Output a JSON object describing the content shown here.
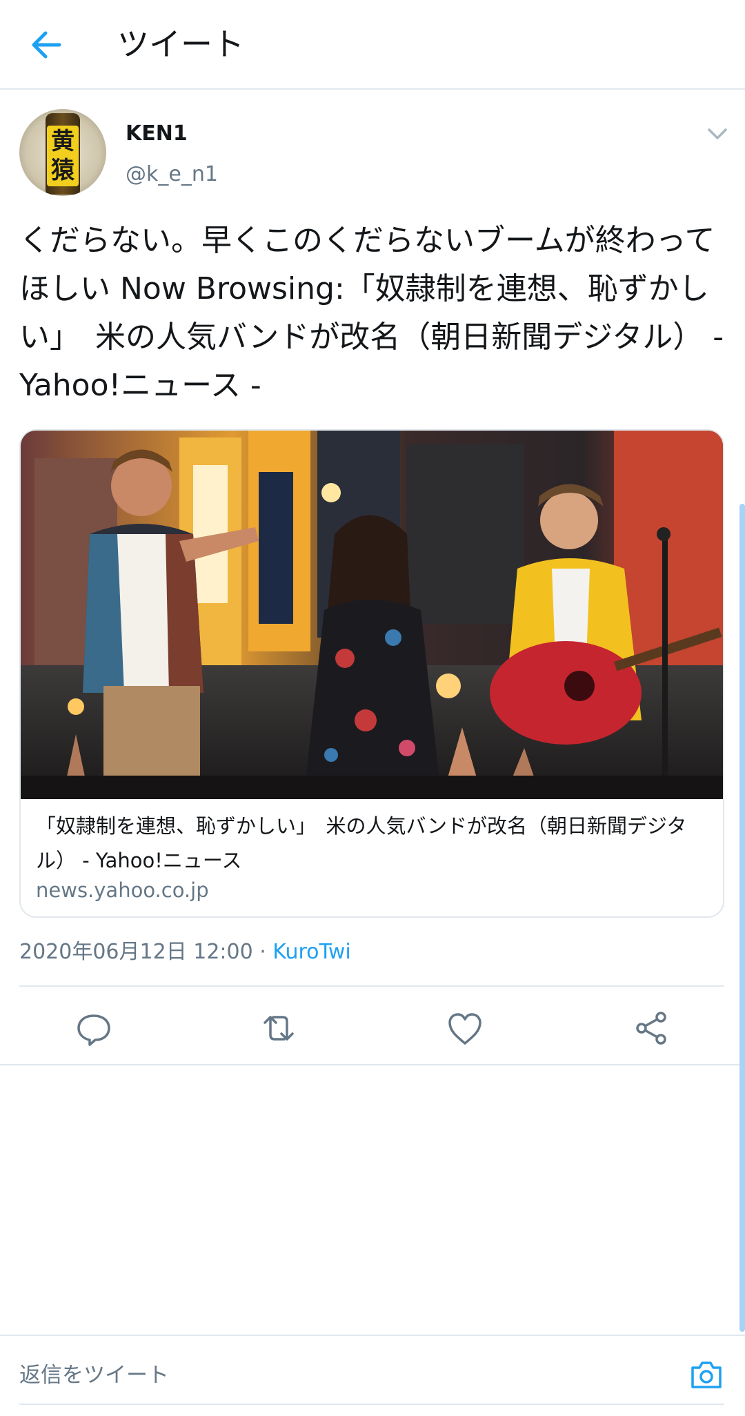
{
  "header": {
    "title": "ツイート"
  },
  "author": {
    "name": "KEN1",
    "handle": "@k_e_n1",
    "avatar_text": "黄猿"
  },
  "tweet": {
    "text": "くだらない。早くこのくだらないブームが終わってほしい Now Browsing:「奴隷制を連想、恥ずかしい」　米の人気バンドが改名（朝日新聞デジタル） - Yahoo!ニュース -"
  },
  "card": {
    "title": "「奴隷制を連想、恥ずかしい」　米の人気バンドが改名（朝日新聞デジタル） - Yahoo!ニュース",
    "domain": "news.yahoo.co.jp"
  },
  "meta": {
    "timestamp": "2020年06月12日 12:00",
    "separator": " · ",
    "via": "KuroTwi"
  },
  "reply": {
    "placeholder": "返信をツイート"
  },
  "colors": {
    "accent": "#1da1f2",
    "text": "#14171a",
    "muted": "#657786",
    "border": "#e1e8ed"
  }
}
